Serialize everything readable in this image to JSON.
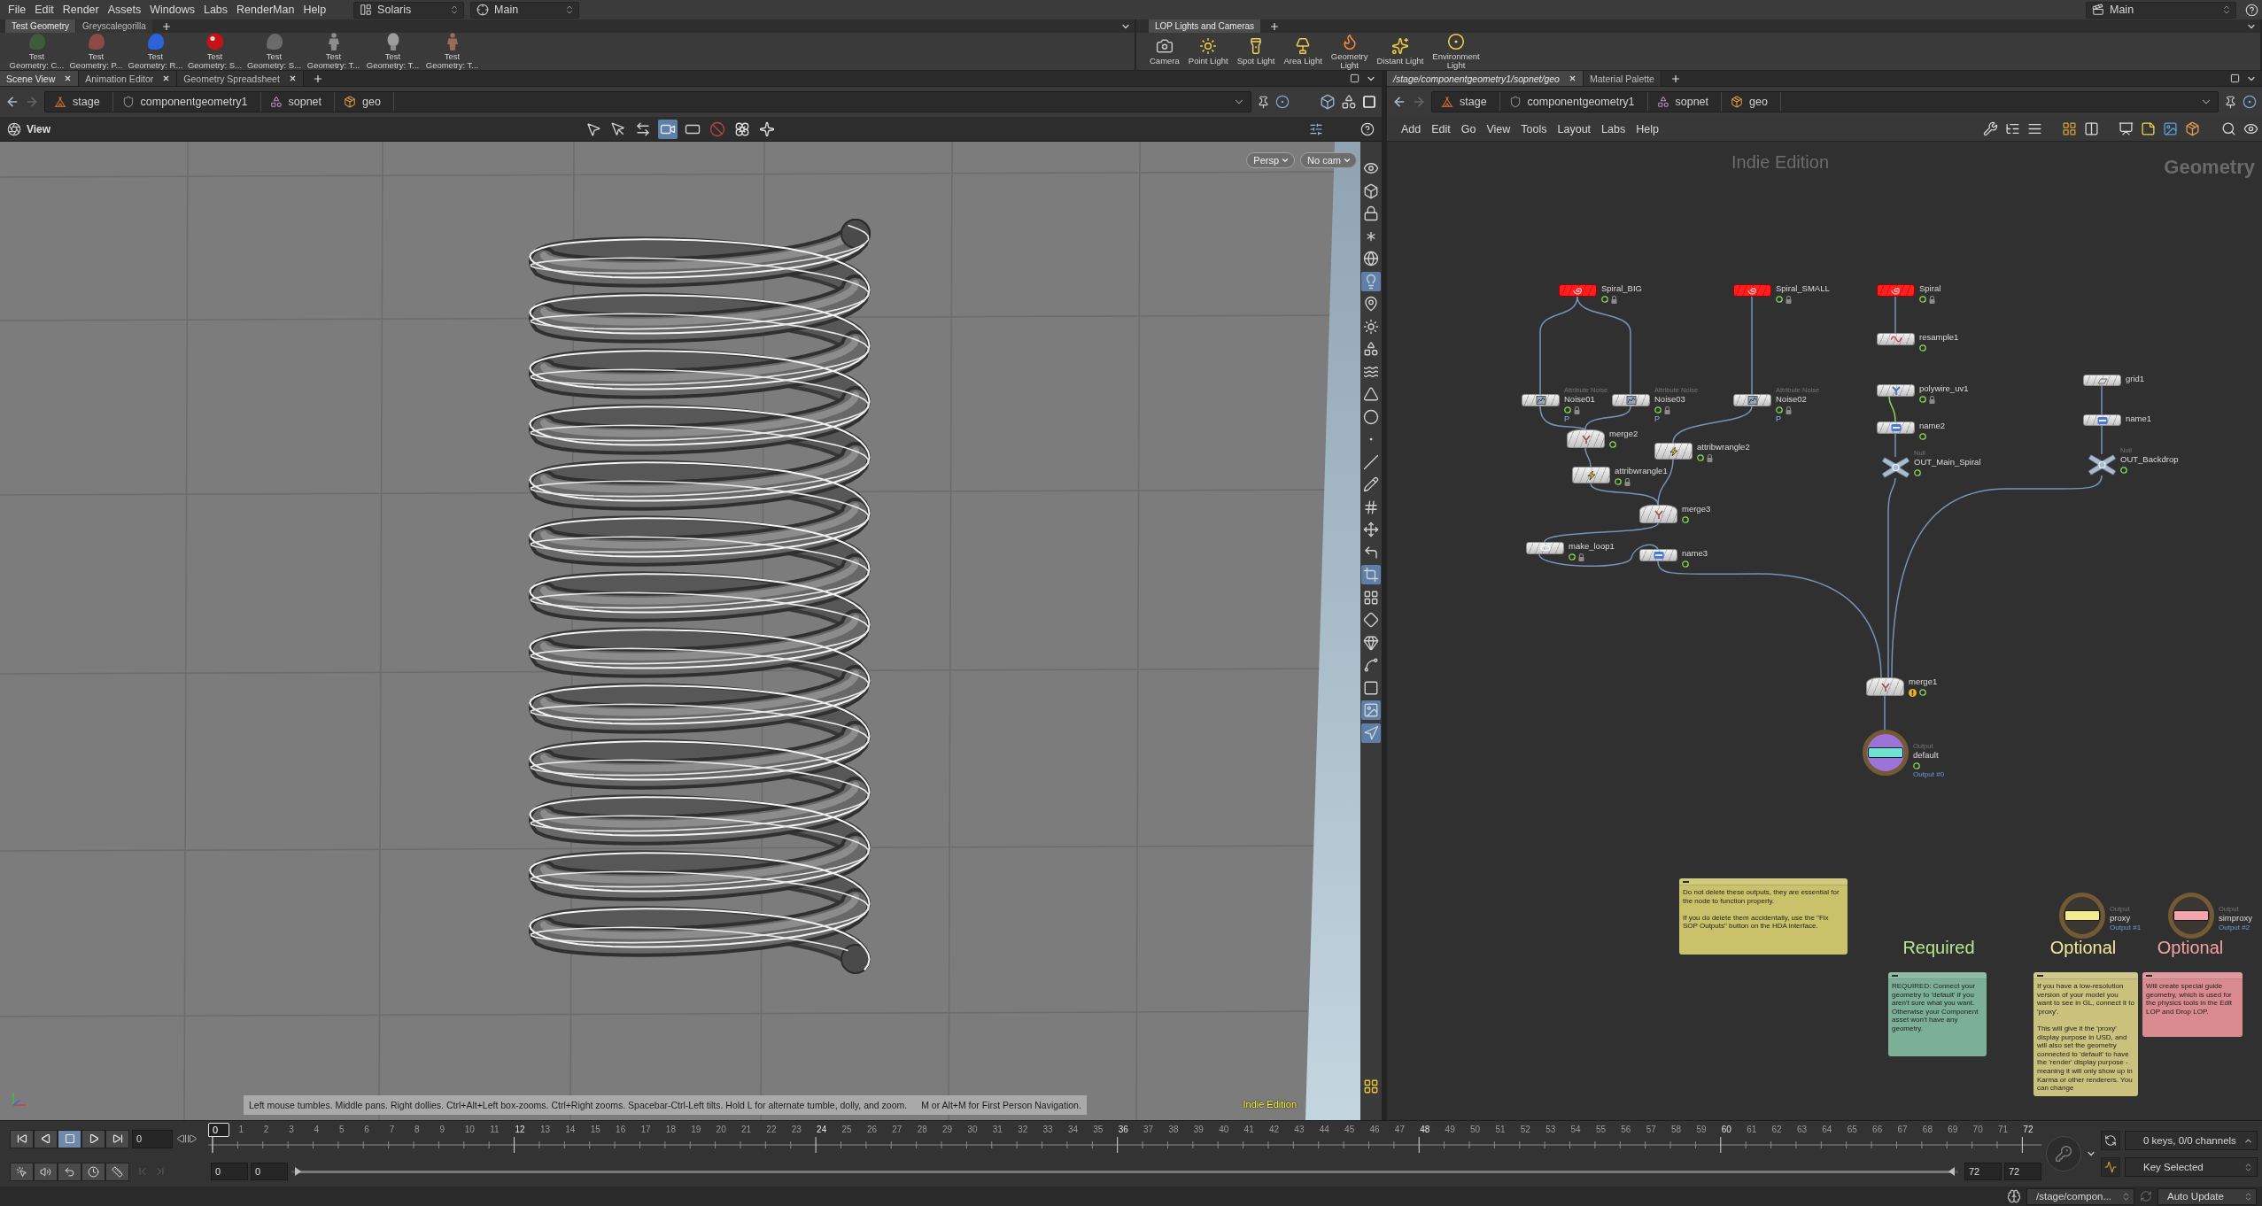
{
  "menu_bar": {
    "items": [
      "File",
      "Edit",
      "Render",
      "Assets",
      "Windows",
      "Labs",
      "RenderMan",
      "Help"
    ],
    "desktop": "Solaris",
    "context": "Main",
    "right_context": "Main"
  },
  "shelves": [
    {
      "tabs": [
        {
          "label": "Test Geometry",
          "selected": true
        },
        {
          "label": "Greyscalegorilla",
          "selected": false
        }
      ],
      "tools": [
        "Test\nGeometry: C...",
        "Test\nGeometry: P...",
        "Test\nGeometry: R...",
        "Test\nGeometry: S...",
        "Test\nGeometry: S...",
        "Test\nGeometry: T...",
        "Test\nGeometry: T...",
        "Test\nGeometry: T..."
      ]
    },
    {
      "tabs": [
        {
          "label": "LOP Lights and Cameras",
          "selected": true
        }
      ],
      "tools": [
        "Camera",
        "Point Light",
        "Spot Light",
        "Area Light",
        "Geometry\nLight",
        "Distant Light",
        "Environment\nLight"
      ]
    }
  ],
  "scene_pane": {
    "tabs": [
      {
        "label": "Scene View",
        "selected": true,
        "closable": true
      },
      {
        "label": "Animation Editor",
        "selected": false,
        "closable": true
      },
      {
        "label": "Geometry Spreadsheet",
        "selected": false,
        "closable": true
      }
    ],
    "path": [
      "stage",
      "componentgeometry1",
      "sopnet",
      "geo"
    ],
    "viewport": {
      "menu": "View",
      "tools": [
        {
          "selected": false
        },
        {
          "selected": false
        },
        {
          "selected": false
        },
        {
          "selected": true
        },
        {
          "selected": false
        },
        {
          "selected": false
        },
        {
          "selected": false
        },
        {
          "selected": false
        }
      ],
      "view_menus": [
        "Persp",
        "No cam"
      ],
      "side_tools": [
        {
          "selected": false
        },
        {
          "selected": false
        },
        {
          "selected": false
        },
        {
          "selected": false
        },
        {
          "selected": false
        },
        {
          "selected": true
        },
        {
          "selected": false
        },
        {
          "selected": false
        },
        {
          "selected": false
        },
        {
          "selected": false
        },
        {
          "selected": false
        },
        {
          "selected": false
        },
        {
          "selected": false
        },
        {
          "selected": false
        },
        {
          "selected": false
        },
        {
          "selected": false
        },
        {
          "selected": false
        },
        {
          "selected": false
        },
        {
          "selected": true
        },
        {
          "selected": false
        },
        {
          "selected": false
        },
        {
          "selected": false
        },
        {
          "selected": false
        },
        {
          "selected": false
        },
        {
          "selected": true
        },
        {
          "selected": true
        }
      ],
      "hint": "Left mouse tumbles. Middle pans. Right dollies. Ctrl+Alt+Left box-zooms. Ctrl+Right zooms. Spacebar-Ctrl-Left tilts. Hold L for alternate tumble, dolly, and zoom.",
      "hint_extra": "M or Alt+M for First Person Navigation.",
      "edition": "Indie Edition"
    }
  },
  "network_pane": {
    "tabs": [
      {
        "label": "/stage/componentgeometry1/sopnet/geo",
        "selected": true,
        "closable": true
      },
      {
        "label": "Material Palette",
        "selected": false,
        "closable": false
      }
    ],
    "path": [
      "stage",
      "componentgeometry1",
      "sopnet",
      "geo"
    ],
    "menu": [
      "Add",
      "Edit",
      "Go",
      "View",
      "Tools",
      "Layout",
      "Labs",
      "Help"
    ],
    "edition": "Indie Edition",
    "context": "Geometry",
    "nodes": [
      {
        "name": "Spiral_BIG",
        "kind": "generator",
        "flagged": true,
        "locked": true,
        "warning": false
      },
      {
        "name": "Spiral_SMALL",
        "kind": "generator",
        "flagged": true,
        "locked": true,
        "warning": false
      },
      {
        "name": "Spiral",
        "kind": "generator",
        "flagged": true,
        "locked": true,
        "warning": false
      },
      {
        "name": "Noise01",
        "kind": "noise",
        "type_label": "Attribute Noise",
        "attribute": "P",
        "flagged": true,
        "locked": true,
        "warning": false
      },
      {
        "name": "Noise03",
        "kind": "noise",
        "type_label": "Attribute Noise",
        "attribute": "P",
        "flagged": true,
        "locked": true,
        "warning": false
      },
      {
        "name": "Noise02",
        "kind": "noise",
        "type_label": "Attribute Noise",
        "attribute": "P",
        "flagged": true,
        "locked": true,
        "warning": false
      },
      {
        "name": "resample1",
        "kind": "resample",
        "flagged": true,
        "locked": false,
        "warning": false
      },
      {
        "name": "polywire_uv1",
        "kind": "polywire",
        "flagged": true,
        "locked": true,
        "warning": false
      },
      {
        "name": "name2",
        "kind": "name",
        "flagged": true,
        "locked": false,
        "warning": false
      },
      {
        "name": "OUT_Main_Spiral",
        "kind": "null",
        "type_label": "Null",
        "flagged": true,
        "locked": false,
        "warning": false
      },
      {
        "name": "grid1",
        "kind": "grid",
        "flagged": false,
        "locked": false,
        "warning": false
      },
      {
        "name": "name1",
        "kind": "name",
        "flagged": false,
        "locked": false,
        "warning": false
      },
      {
        "name": "OUT_Backdrop",
        "kind": "null",
        "type_label": "Null",
        "flagged": true,
        "locked": false,
        "warning": false
      },
      {
        "name": "merge2",
        "kind": "merge",
        "flagged": true,
        "locked": false,
        "warning": false
      },
      {
        "name": "attribwrangle2",
        "kind": "wrangle",
        "flagged": true,
        "locked": true,
        "warning": false
      },
      {
        "name": "attribwrangle1",
        "kind": "wrangle",
        "flagged": true,
        "locked": true,
        "warning": false
      },
      {
        "name": "merge3",
        "kind": "merge",
        "flagged": true,
        "locked": false,
        "warning": false
      },
      {
        "name": "make_loop1",
        "kind": "subnet",
        "flagged": true,
        "locked": true,
        "warning": false
      },
      {
        "name": "name3",
        "kind": "name",
        "flagged": true,
        "locked": false,
        "warning": false
      },
      {
        "name": "merge1",
        "kind": "merge",
        "flagged": true,
        "locked": false,
        "warning": true
      },
      {
        "name": "default",
        "kind": "output",
        "type_label": "Output",
        "output_label": "Output #0",
        "color": "#6fe3d2",
        "display": true,
        "flagged": true,
        "locked": false,
        "warning": false
      },
      {
        "name": "proxy",
        "kind": "output",
        "type_label": "Output",
        "output_label": "Output #1",
        "color": "#f4ec8c",
        "display": false,
        "flagged": false,
        "locked": false,
        "warning": false
      },
      {
        "name": "simproxy",
        "kind": "output",
        "type_label": "Output",
        "output_label": "Output #2",
        "color": "#f3a4ad",
        "display": false,
        "flagged": false,
        "locked": false,
        "warning": false
      }
    ],
    "headings": [
      {
        "text": "Required",
        "color": "#b8e690"
      },
      {
        "text": "Optional",
        "color": "#f1e99a"
      },
      {
        "text": "Optional",
        "color": "#f4a3a3"
      }
    ],
    "notes": [
      {
        "text": "Do not delete these outputs, they are essential for the node to function properly.\n\nIf you do delete them accidentally, use the \"Fix SOP Outputs\" button on the HDA interface.",
        "color": "#c9c26a"
      },
      {
        "text": "REQUIRED: Connect your geometry to 'default' if you aren't sure what you want. Otherwise your Component asset won't have any geometry.",
        "color": "#7caf98"
      },
      {
        "text": "If you have a low-resolution version of your model you want to see in GL, connect it to 'proxy'.\n\nThis will give it the 'proxy' display purpose in USD, and will also set the geometry connected to 'default' to have the 'render' display purpose - meaning it will only show up in Karma or other renderers. You can change",
        "color": "#c9c17c"
      },
      {
        "text": "Will create special guide geometry, which is used for the physics tools in the Edit LOP and Drop LOP.",
        "color": "#d98b90"
      }
    ]
  },
  "timeline": {
    "frame": "0",
    "frame_marker": "0",
    "ticks": [
      "1",
      "2",
      "3",
      "4",
      "5",
      "6",
      "7",
      "8",
      "9",
      "10",
      "11",
      "12",
      "13",
      "14",
      "15",
      "16",
      "17",
      "18",
      "19",
      "20",
      "21",
      "22",
      "23",
      "24",
      "25",
      "26",
      "27",
      "28",
      "29",
      "30",
      "31",
      "32",
      "33",
      "34",
      "35",
      "36",
      "37",
      "38",
      "39",
      "40",
      "41",
      "42",
      "43",
      "44",
      "45",
      "46",
      "47",
      "48",
      "49",
      "50",
      "51",
      "52",
      "53",
      "54",
      "55",
      "56",
      "57",
      "58",
      "59",
      "60",
      "61",
      "62",
      "63",
      "64",
      "65",
      "66",
      "67",
      "68",
      "69",
      "70",
      "71",
      "72"
    ],
    "playback": [
      {
        "selected": false
      },
      {
        "selected": false
      },
      {
        "selected": true
      },
      {
        "selected": false
      },
      {
        "selected": false
      }
    ],
    "range_start": [
      "0",
      "0"
    ],
    "range_bar": {
      "level": 1
    },
    "range_end": [
      "72",
      "72"
    ],
    "keys": "0 keys, 0/0 channels",
    "key_mode": "Key Selected"
  },
  "status_bar": {
    "path": "/stage/compon...",
    "update_mode": "Auto Update"
  }
}
